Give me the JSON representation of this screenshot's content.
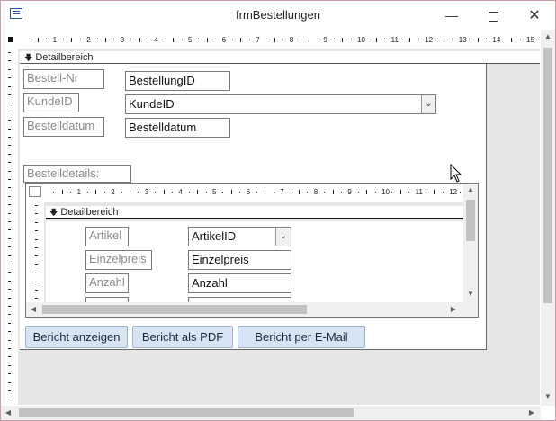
{
  "window": {
    "title": "frmBestellungen",
    "minimize_icon": "minimize-icon",
    "maximize_icon": "maximize-icon",
    "close_icon": "close-icon",
    "app_icon": "form-icon"
  },
  "ruler": {
    "numbers": [
      "1",
      "2",
      "3",
      "4",
      "5",
      "6",
      "7",
      "8",
      "9",
      "10",
      "11",
      "12",
      "13",
      "14",
      "15"
    ]
  },
  "detail_section": {
    "label": "Detailbereich"
  },
  "fields": {
    "bestell_nr_label": "Bestell-Nr",
    "bestell_nr_value": "BestellungID",
    "kunde_label": "KundeID",
    "kunde_value": "KundeID",
    "datum_label": "Bestelldatum",
    "datum_value": "Bestelldatum"
  },
  "subform": {
    "label": "Bestelldetails:",
    "section_label": "Detailbereich",
    "ruler_numbers": [
      "1",
      "2",
      "3",
      "4",
      "5",
      "6",
      "7",
      "8",
      "9",
      "10",
      "11",
      "12"
    ],
    "artikel_label": "Artikel",
    "artikel_value": "ArtikelID",
    "preis_label": "Einzelpreis",
    "preis_value": "Einzelpreis",
    "anzahl_label": "Anzahl",
    "anzahl_value": "Anzahl"
  },
  "buttons": {
    "show_report": "Bericht anzeigen",
    "report_pdf": "Bericht als PDF",
    "report_email": "Bericht per E-Mail"
  }
}
